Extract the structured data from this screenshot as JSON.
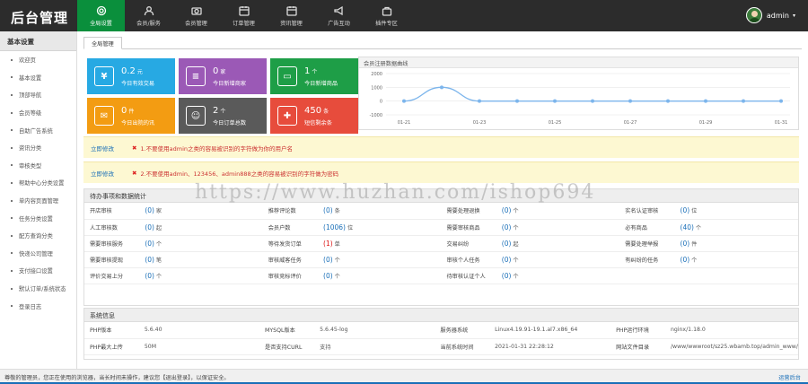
{
  "app": {
    "title": "后台管理",
    "user": "admin"
  },
  "nav": [
    {
      "label": "全局设置",
      "icon": "gear-icon",
      "active": true
    },
    {
      "label": "会员/服务",
      "icon": "user-icon"
    },
    {
      "label": "会员管理",
      "icon": "camera-icon"
    },
    {
      "label": "订单管理",
      "icon": "calendar-icon"
    },
    {
      "label": "资讯管理",
      "icon": "calendar-icon"
    },
    {
      "label": "广告互动",
      "icon": "megaphone-icon"
    },
    {
      "label": "插件专区",
      "icon": "bag-icon"
    }
  ],
  "sidebar": {
    "header": "基本设置",
    "items": [
      "欢迎页",
      "基本设置",
      "顶部导航",
      "会员等级",
      "自助广告系统",
      "资讯分类",
      "审核类型",
      "帮助中心分类设置",
      "单内容页面管理",
      "任务分类设置",
      "配方查询分类",
      "快递公司管理",
      "支付接口设置",
      "默认订单/系统状态",
      "登录日志"
    ]
  },
  "tab": {
    "label": "全局管理"
  },
  "tiles": [
    {
      "value": "0.2",
      "unit": "元",
      "label": "今日有效交易",
      "color": "#27a9e3",
      "icon": "¥"
    },
    {
      "value": "0",
      "unit": "家",
      "label": "今日新增商家",
      "color": "#9b59b6",
      "icon": "≡"
    },
    {
      "value": "1",
      "unit": "个",
      "label": "今日新增商品",
      "color": "#1e9e47",
      "icon": "▭"
    },
    {
      "value": "0",
      "unit": "件",
      "label": "今日出院的讯",
      "color": "#f39c12",
      "icon": "✉"
    },
    {
      "value": "2",
      "unit": "个",
      "label": "今日订单总数",
      "color": "#5a5a5a",
      "icon": "☺"
    },
    {
      "value": "450",
      "unit": "条",
      "label": "短信剩余条",
      "color": "#e74c3c",
      "icon": "✚"
    }
  ],
  "chart_data": {
    "type": "line",
    "title": "会员注册数据曲线",
    "x": [
      "01-21",
      "01-22",
      "01-23",
      "01-24",
      "01-25",
      "01-26",
      "01-27",
      "01-28",
      "01-29",
      "01-30",
      "01-31"
    ],
    "xticks": [
      "01-21",
      "01-23",
      "01-25",
      "01-27",
      "01-29",
      "01-31"
    ],
    "y": [
      0,
      1000,
      0,
      0,
      0,
      0,
      0,
      0,
      0,
      0,
      0
    ],
    "yticks": [
      2000,
      1000,
      0,
      -1000
    ],
    "ylim": [
      -1000,
      2000
    ],
    "color": "#7cb5ec"
  },
  "notices": [
    {
      "link": "立即修改",
      "text": "1.不要使用admin之类的容易被识别的字符做为你的用户名"
    },
    {
      "link": "立即修改",
      "text": "2.不要使用admin、123456、admin888之类的容易被识别的字符做为密码"
    }
  ],
  "todo": {
    "title": "待办事项和数据统计",
    "rows": [
      [
        {
          "l": "开店审核",
          "v": "(0)",
          "u": "家"
        },
        {
          "l": "推荐评论数",
          "v": "(0)",
          "u": "条"
        },
        {
          "l": "需要处理退换",
          "v": "(0)",
          "u": "个"
        },
        {
          "l": "实名认证审核",
          "v": "(0)",
          "u": "位"
        }
      ],
      [
        {
          "l": "人工审核数",
          "v": "(0)",
          "u": "起"
        },
        {
          "l": "会员户数",
          "v": "(1006)",
          "u": "位"
        },
        {
          "l": "需要审核商品",
          "v": "(0)",
          "u": "个"
        },
        {
          "l": "必有商品",
          "v": "(40)",
          "u": "个"
        }
      ],
      [
        {
          "l": "需要审核服务",
          "v": "(0)",
          "u": "个"
        },
        {
          "l": "等待发货订单",
          "v": "(1)",
          "u": "单",
          "red": true
        },
        {
          "l": "交易纠纷",
          "v": "(0)",
          "u": "起"
        },
        {
          "l": "需要处理举报",
          "v": "(0)",
          "u": "件"
        }
      ],
      [
        {
          "l": "需要审核提现",
          "v": "(0)",
          "u": "笔"
        },
        {
          "l": "审核威客任务",
          "v": "(0)",
          "u": "个"
        },
        {
          "l": "审核个人任务",
          "v": "(0)",
          "u": "个"
        },
        {
          "l": "有纠纷的任务",
          "v": "(0)",
          "u": "个"
        }
      ],
      [
        {
          "l": "评价交易上分",
          "v": "(0)",
          "u": "个"
        },
        {
          "l": "审核竞标评价",
          "v": "(0)",
          "u": "个"
        },
        {
          "l": "待审核认证个人",
          "v": "(0)",
          "u": "个"
        },
        {
          "l": "",
          "v": "",
          "u": ""
        }
      ]
    ]
  },
  "sys": {
    "title": "系统信息",
    "rows": [
      [
        {
          "l": "PHP版本",
          "v": "5.6.40"
        },
        {
          "l": "MYSQL版本",
          "v": "5.6.45-log"
        },
        {
          "l": "服务器系统",
          "v": "Linux4.19.91-19.1.al7.x86_64"
        },
        {
          "l": "PHP运行环境",
          "v": "nginx/1.18.0"
        }
      ],
      [
        {
          "l": "PHP最大上传",
          "v": "50M"
        },
        {
          "l": "是否支持CURL",
          "v": "支持"
        },
        {
          "l": "当前系统时间",
          "v": "2021-01-31 22:28:12"
        },
        {
          "l": "网站文件目录",
          "v": "/www/wwwroot/sz25.wbamb.top/admin_www/"
        }
      ]
    ]
  },
  "footer": {
    "text": "尊敬的管理员，您正在使用的浏览器，当长时间未操作，建议您【退出登录】，以保证安全。",
    "right": "运营后台"
  },
  "watermark": "https://www.huzhan.com/ishop694"
}
